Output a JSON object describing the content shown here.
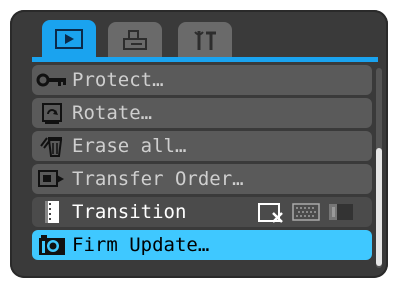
{
  "tabs": [
    {
      "icon": "play-icon",
      "state": "active"
    },
    {
      "icon": "print-icon",
      "state": "inactive"
    },
    {
      "icon": "setup-icon",
      "state": "inactive"
    }
  ],
  "menu": {
    "items": [
      {
        "label": "Protect…",
        "icon": "key-icon"
      },
      {
        "label": "Rotate…",
        "icon": "rotate-icon"
      },
      {
        "label": "Erase all…",
        "icon": "trash-icon"
      },
      {
        "label": "Transfer Order…",
        "icon": "transfer-icon"
      },
      {
        "label": "Transition",
        "icon": "transition-icon"
      },
      {
        "label": "Firm Update…",
        "icon": "camera-icon"
      }
    ],
    "selected_index": 5,
    "transition_options": [
      "fade-x-icon",
      "dissolve-icon",
      "slide-icon"
    ]
  },
  "colors": {
    "accent": "#1aa3ef",
    "highlight": "#3fc8ff",
    "row_bg": "#5a5a5a"
  }
}
